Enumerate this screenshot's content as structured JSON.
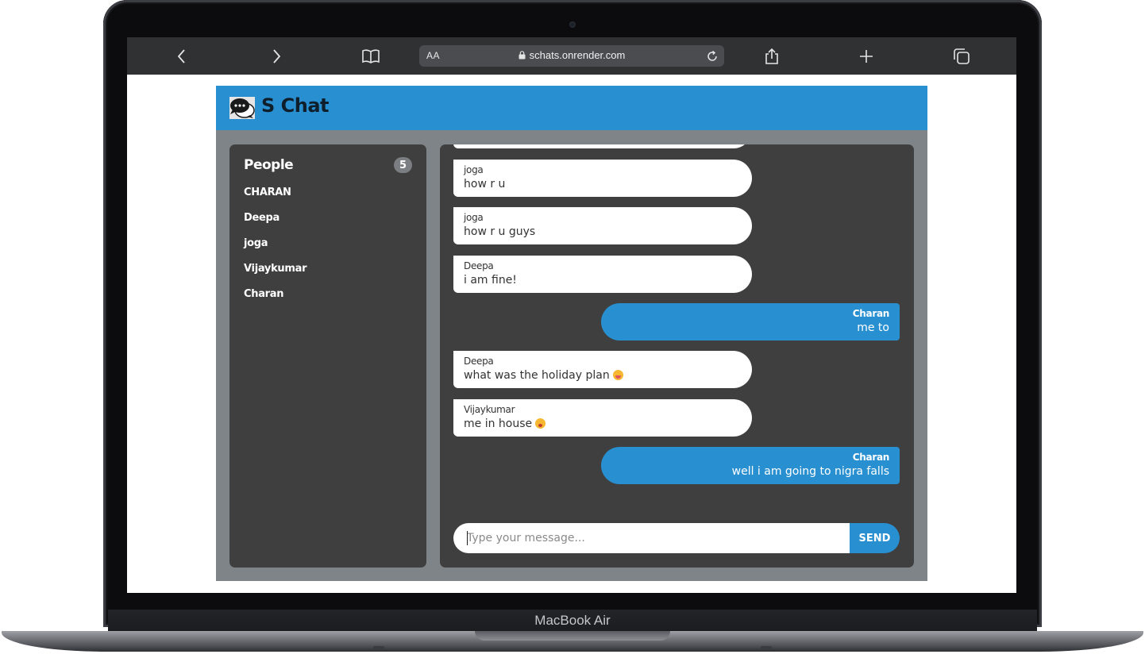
{
  "device": {
    "brand_label": "MacBook Air"
  },
  "browser": {
    "reader_label": "AA",
    "url": "schats.onrender.com"
  },
  "app": {
    "title": "S Chat",
    "accent_color": "#288fd0",
    "people": {
      "title": "People",
      "count": "5",
      "list": [
        "CHARAN",
        "Deepa",
        "joga",
        "Vijaykumar",
        "Charan"
      ]
    },
    "messages": [
      {
        "from": "joga",
        "text": "how r u",
        "direction": "in"
      },
      {
        "from": "joga",
        "text": "how r u guys",
        "direction": "in"
      },
      {
        "from": "Deepa",
        "text": "i am fine!",
        "direction": "in"
      },
      {
        "from": "Charan",
        "text": "me to",
        "direction": "out"
      },
      {
        "from": "Deepa",
        "text": "what was the holiday plan",
        "emoji": "face-savoring-food-icon",
        "direction": "in"
      },
      {
        "from": "Vijaykumar",
        "text": "me in house",
        "emoji": "pleading-face-icon",
        "direction": "in"
      },
      {
        "from": "Charan",
        "text": "well i am going to nigra falls",
        "direction": "out"
      }
    ],
    "compose": {
      "placeholder": "Type your message...",
      "send_label": "SEND"
    }
  }
}
